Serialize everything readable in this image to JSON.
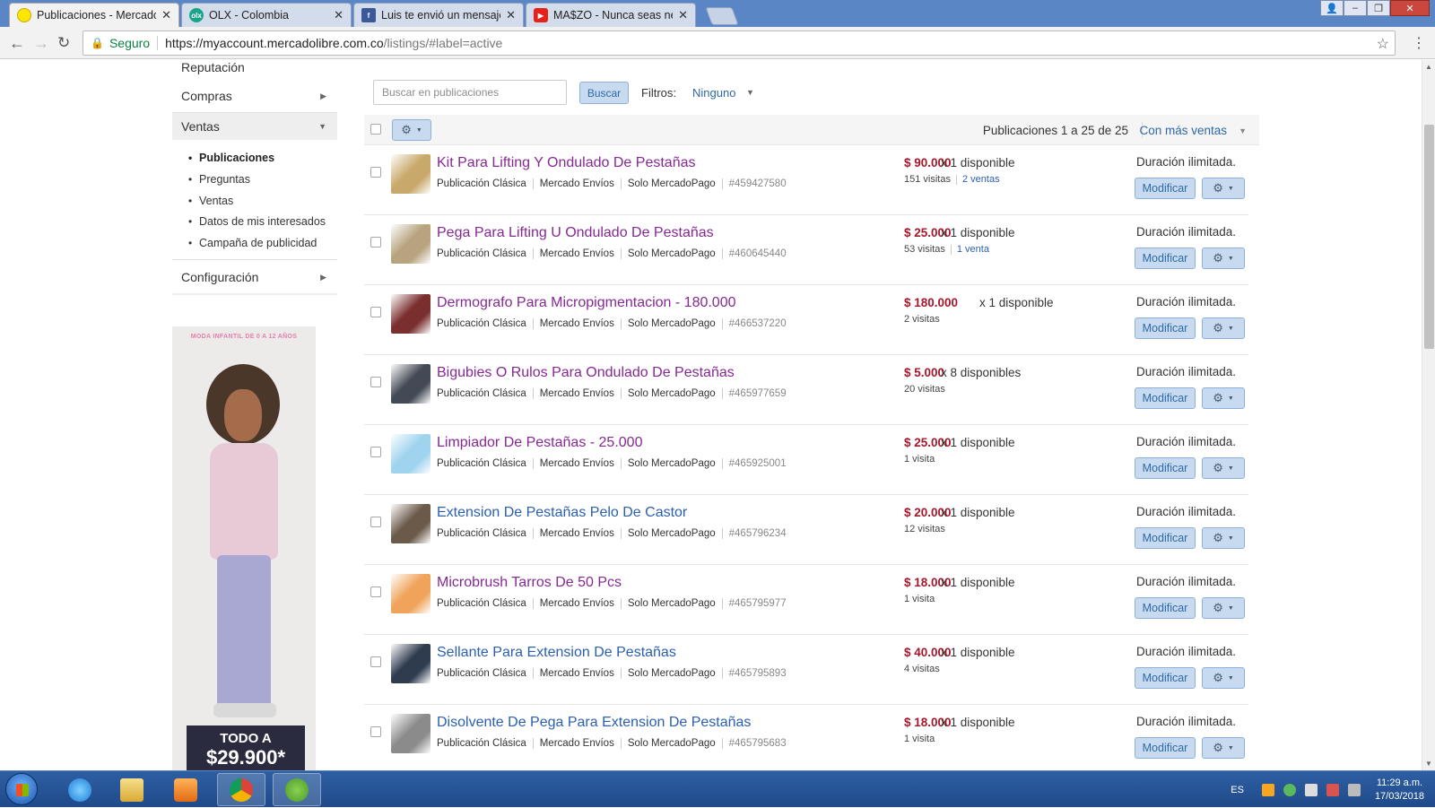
{
  "tabs": [
    {
      "title": "Publicaciones - Mercadolibre",
      "active": true,
      "favicon": "mercadolibre-icon"
    },
    {
      "title": "OLX - Colombia",
      "active": false,
      "favicon": "olx-icon"
    },
    {
      "title": "Luis te envió un mensaje",
      "active": false,
      "favicon": "facebook-icon"
    },
    {
      "title": "MA$ZO - Nunca seas ne",
      "active": false,
      "favicon": "youtube-icon"
    }
  ],
  "omnibox": {
    "secure_label": "Seguro",
    "url_host": "https://myaccount.mercadolibre.com.co",
    "url_path": "/listings/#label=active"
  },
  "sidebar": {
    "reputacion": "Reputación",
    "compras": "Compras",
    "ventas": "Ventas",
    "sub_items": [
      "Publicaciones",
      "Preguntas",
      "Ventas",
      "Datos de mis interesados",
      "Campaña de publicidad"
    ],
    "configuracion": "Configuración"
  },
  "ad": {
    "top_text": "MODA INFANTIL DE 0 A 12 AÑOS",
    "promo_line1": "TODO A",
    "promo_line2": "$29.900*"
  },
  "toolbar": {
    "search_placeholder": "Buscar en publicaciones",
    "search_button": "Buscar",
    "filters_label": "Filtros:",
    "filters_value": "Ninguno",
    "count_text": "Publicaciones 1 a 25 de 25",
    "sort_label": "Con más ventas"
  },
  "common": {
    "type": "Publicación Clásica",
    "shipping": "Mercado Envíos",
    "payment": "Solo MercadoPago",
    "duration": "Duración ilimitada.",
    "modify": "Modificar"
  },
  "listings": [
    {
      "title": "Kit Para Lifting Y Ondulado De Pestañas",
      "visited": true,
      "id": "#459427580",
      "price": "$ 90.000",
      "avail": "x 1 disponible",
      "visits": "151 visitas",
      "sales": "2 ventas",
      "thumb_color": "#c9a96b"
    },
    {
      "title": "Pega Para Lifting U Ondulado De Pestañas",
      "visited": true,
      "id": "#460645440",
      "price": "$ 25.000",
      "avail": "x 1 disponible",
      "visits": "53 visitas",
      "sales": "1 venta",
      "thumb_color": "#b7a37e"
    },
    {
      "title": "Dermografo Para Micropigmentacion - 180.000",
      "visited": true,
      "id": "#466537220",
      "price": "$ 180.000",
      "avail": "x 1 disponible",
      "visits": "2 visitas",
      "sales": "",
      "thumb_color": "#7a2e2e"
    },
    {
      "title": "Bigubies O Rulos Para Ondulado De Pestañas",
      "visited": true,
      "id": "#465977659",
      "price": "$ 5.000",
      "avail": "x 8 disponibles",
      "visits": "20 visitas",
      "sales": "",
      "thumb_color": "#444a55"
    },
    {
      "title": "Limpiador De Pestañas - 25.000",
      "visited": true,
      "id": "#465925001",
      "price": "$ 25.000",
      "avail": "x 1 disponible",
      "visits": "1 visita",
      "sales": "",
      "thumb_color": "#9fd3ee"
    },
    {
      "title": "Extension De Pestañas Pelo De Castor",
      "visited": false,
      "id": "#465796234",
      "price": "$ 20.000",
      "avail": "x 1 disponible",
      "visits": "12 visitas",
      "sales": "",
      "thumb_color": "#6b5a4a"
    },
    {
      "title": "Microbrush Tarros De 50 Pcs",
      "visited": true,
      "id": "#465795977",
      "price": "$ 18.000",
      "avail": "x 1 disponible",
      "visits": "1 visita",
      "sales": "",
      "thumb_color": "#f0a35a"
    },
    {
      "title": "Sellante Para Extension De Pestañas",
      "visited": false,
      "id": "#465795893",
      "price": "$ 40.000",
      "avail": "x 1 disponible",
      "visits": "4 visitas",
      "sales": "",
      "thumb_color": "#2f3b4f"
    },
    {
      "title": "Disolvente De Pega Para Extension De Pestañas",
      "visited": false,
      "id": "#465795683",
      "price": "$ 18.000",
      "avail": "x 1 disponible",
      "visits": "1 visita",
      "sales": "",
      "thumb_color": "#8b8b8b"
    }
  ],
  "taskbar": {
    "apps": [
      "internet-explorer-icon",
      "file-explorer-icon",
      "media-player-icon",
      "chrome-icon",
      "utorrent-icon"
    ],
    "lang": "ES",
    "time": "11:29 a.m.",
    "date": "17/03/2018"
  }
}
